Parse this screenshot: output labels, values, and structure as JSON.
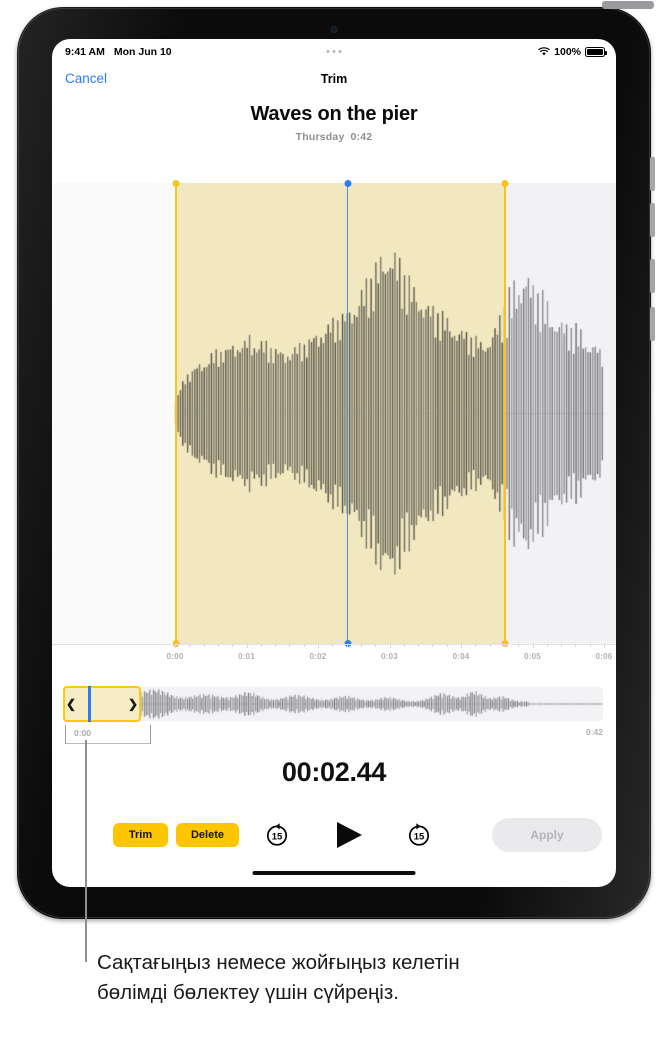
{
  "status_bar": {
    "time": "9:41 AM",
    "date": "Mon Jun 10",
    "battery_percent": "100%",
    "wifi_icon": "wifi-icon",
    "battery_icon": "battery-icon",
    "multitask_icon": "multitasking-dots-icon"
  },
  "nav": {
    "cancel_label": "Cancel",
    "title": "Trim"
  },
  "recording": {
    "title": "Waves on the pier",
    "day": "Thursday",
    "duration": "0:42"
  },
  "ruler": {
    "labels": [
      "0:00",
      "0:01",
      "0:02",
      "0:03",
      "0:04",
      "0:05",
      "0:06"
    ]
  },
  "mini_timeline": {
    "start_label": "0:00",
    "end_label": "0:42",
    "left_handle_icon": "chevron-left-icon",
    "right_handle_icon": "chevron-right-icon",
    "playhead_icon": "playhead-icon"
  },
  "playback": {
    "current_time": "00:02.44"
  },
  "controls": {
    "trim_label": "Trim",
    "delete_label": "Delete",
    "skip_back_label": "15",
    "skip_forward_label": "15",
    "skip_back_icon": "skip-back-15-icon",
    "play_icon": "play-icon",
    "skip_forward_icon": "skip-forward-15-icon",
    "apply_label": "Apply",
    "apply_enabled": false
  },
  "caption": {
    "text": "Сақтағыңыз немесе жойғыңыз келетін бөлімді бөлектеу үшін сүйреңіз."
  },
  "colors": {
    "accent_yellow": "#FDC600",
    "handle_yellow": "#F5C518",
    "selection_fill": "#F2E8C0",
    "playhead_blue": "#2B7CF6",
    "link_blue": "#2B7CF6",
    "panel_gray": "#F2F2F4",
    "disabled_gray": "#EAEAEC"
  },
  "chart_data": {
    "type": "area",
    "title": "Audio waveform",
    "xlabel": "",
    "ylabel": "",
    "x_ticks": [
      "0:00",
      "0:01",
      "0:02",
      "0:03",
      "0:04",
      "0:05",
      "0:06"
    ],
    "selection_start": "0:00",
    "selection_end": "0:04.6",
    "playhead": "00:02.44",
    "amplitudes_main": [
      0.06,
      0.1,
      0.14,
      0.17,
      0.2,
      0.23,
      0.21,
      0.25,
      0.24,
      0.27,
      0.26,
      0.29,
      0.27,
      0.31,
      0.29,
      0.33,
      0.3,
      0.34,
      0.32,
      0.36,
      0.34,
      0.37,
      0.35,
      0.38,
      0.36,
      0.39,
      0.37,
      0.41,
      0.38,
      0.4,
      0.39,
      0.42,
      0.4,
      0.38,
      0.41,
      0.37,
      0.4,
      0.36,
      0.39,
      0.35,
      0.38,
      0.34,
      0.37,
      0.33,
      0.36,
      0.32,
      0.35,
      0.33,
      0.36,
      0.34,
      0.37,
      0.35,
      0.38,
      0.36,
      0.4,
      0.38,
      0.42,
      0.4,
      0.44,
      0.42,
      0.46,
      0.44,
      0.48,
      0.45,
      0.5,
      0.47,
      0.52,
      0.49,
      0.54,
      0.5,
      0.56,
      0.52,
      0.58,
      0.55,
      0.62,
      0.57,
      0.66,
      0.6,
      0.7,
      0.62,
      0.74,
      0.66,
      0.78,
      0.7,
      0.84,
      0.74,
      0.9,
      0.78,
      0.96,
      0.82,
      1.0,
      0.8,
      0.92,
      0.76,
      0.86,
      0.72,
      0.8,
      0.68,
      0.76,
      0.64,
      0.72,
      0.62,
      0.7,
      0.6,
      0.66,
      0.57,
      0.62,
      0.55,
      0.6,
      0.52,
      0.58,
      0.5,
      0.56,
      0.48,
      0.54,
      0.46,
      0.52,
      0.45,
      0.5,
      0.43,
      0.48,
      0.42,
      0.46,
      0.4,
      0.44,
      0.39,
      0.42,
      0.38,
      0.4,
      0.36,
      0.42,
      0.38,
      0.46,
      0.41,
      0.5,
      0.44,
      0.56,
      0.48,
      0.62,
      0.52,
      0.68,
      0.56,
      0.74,
      0.6,
      0.8,
      0.64,
      0.86,
      0.68,
      0.8,
      0.64,
      0.74,
      0.6,
      0.7,
      0.56,
      0.66,
      0.53,
      0.62,
      0.5,
      0.58,
      0.48,
      0.56,
      0.46,
      0.54,
      0.44,
      0.52,
      0.42,
      0.5,
      0.41,
      0.48,
      0.4,
      0.46,
      0.38,
      0.44,
      0.36,
      0.42,
      0.35,
      0.4,
      0.33,
      0.38,
      0.31
    ]
  }
}
